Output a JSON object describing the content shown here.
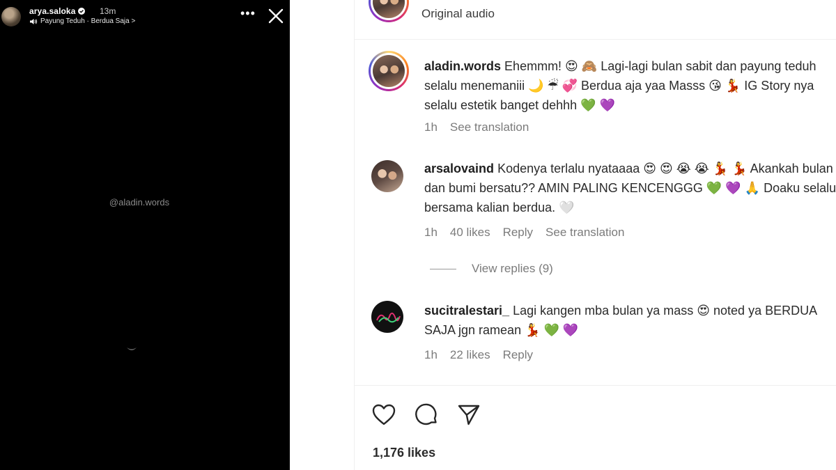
{
  "story": {
    "username": "arya.saloka",
    "time": "13m",
    "music": "Payung Teduh · Berdua Saja >",
    "tag": "@aladin.words"
  },
  "post": {
    "audio_label": "Original audio",
    "comments": [
      {
        "username": "aladin.words",
        "text": "Ehemmm! 😍 🙈 Lagi-lagi bulan sabit dan payung teduh selalu menemaniii 🌙 ☔ 💞 Berdua aja yaa Masss 😘 💃 IG Story nya selalu estetik banget dehhh 💚 💜",
        "time": "1h",
        "translation": "See translation"
      },
      {
        "username": "arsalovaind",
        "text": "Kodenya terlalu nyataaaa 😍 😍 😭 😭 💃 💃 Akankah bulan dan bumi bersatu?? AMIN PALING KENCENGGG 💚 💜 🙏 Doaku selalu bersama kalian berdua. 🤍",
        "time": "1h",
        "likes": "40 likes",
        "reply": "Reply",
        "translation": "See translation"
      },
      {
        "username": "sucitralestari_",
        "text": "Lagi kangen mba bulan ya mass 😍 noted ya BERDUA SAJA jgn ramean 💃 💚 💜",
        "time": "1h",
        "likes": "22 likes",
        "reply": "Reply"
      }
    ],
    "view_replies": "View replies (9)",
    "like_count": "1,176 likes"
  }
}
